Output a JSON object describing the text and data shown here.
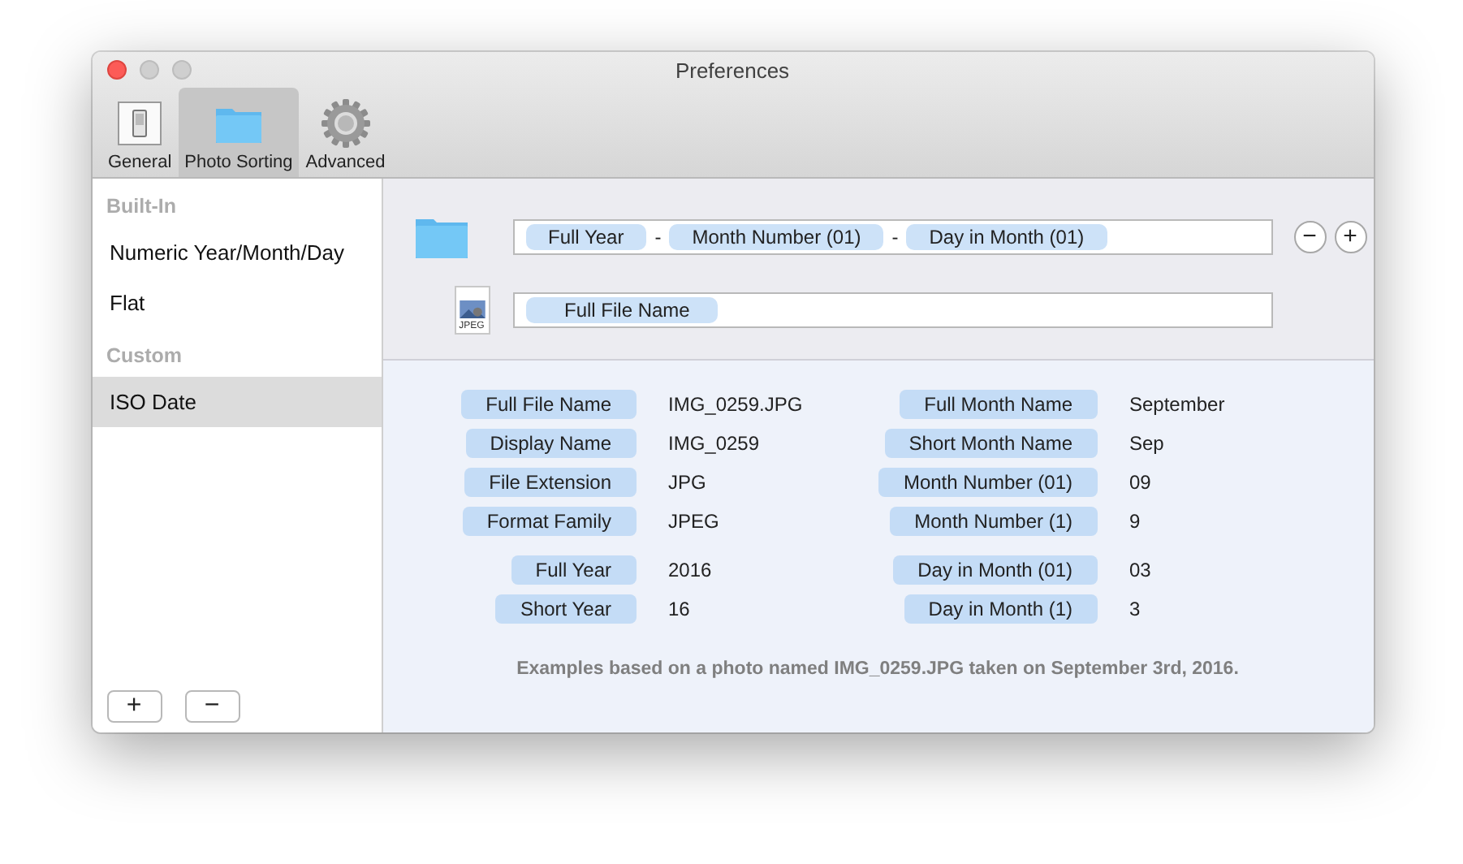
{
  "window": {
    "title": "Preferences"
  },
  "toolbar": [
    {
      "label": "General",
      "kind": "switch",
      "selected": false
    },
    {
      "label": "Photo Sorting",
      "kind": "folder",
      "selected": true
    },
    {
      "label": "Advanced",
      "kind": "gear",
      "selected": false
    }
  ],
  "sidebar": {
    "groups": [
      {
        "heading": "Built-In",
        "items": [
          {
            "label": "Numeric Year/Month/Day",
            "selected": false
          },
          {
            "label": "Flat",
            "selected": false
          }
        ]
      },
      {
        "heading": "Custom",
        "items": [
          {
            "label": "ISO Date",
            "selected": true
          }
        ]
      }
    ],
    "buttons": [
      "+",
      "−"
    ]
  },
  "folder_format": [
    {
      "kind": "token",
      "text": "Full Year"
    },
    {
      "kind": "separator",
      "text": "-"
    },
    {
      "kind": "token",
      "text": "Month Number (01)"
    },
    {
      "kind": "separator",
      "text": "-"
    },
    {
      "kind": "token",
      "text": "Day in Month (01)"
    }
  ],
  "format_buttons": [
    "−",
    "+"
  ],
  "file_format": [
    {
      "kind": "token",
      "text": "Full File Name"
    }
  ],
  "file_icon_label": "JPEG",
  "examples": [
    [
      {
        "token": "Full File Name",
        "value": "IMG_0259.JPG",
        "token_2": "Full Month Name",
        "value_2": "September"
      },
      {
        "token": "Display Name",
        "value": "IMG_0259",
        "token_2": "Short Month Name",
        "value_2": "Sep"
      },
      {
        "token": "File Extension",
        "value": "JPG",
        "token_2": "Month Number (01)",
        "value_2": "09"
      },
      {
        "token": "Format Family",
        "value": "JPEG",
        "token_2": "Month Number (1)",
        "value_2": "9"
      }
    ],
    [
      {
        "token": "Full Year",
        "value": "2016",
        "token_2": "Day in Month (01)",
        "value_2": "03"
      },
      {
        "token": "Short Year",
        "value": "16",
        "token_2": "Day in Month (1)",
        "value_2": "3"
      }
    ]
  ],
  "footnote": "Examples based on a photo named IMG_0259.JPG taken on September 3rd, 2016."
}
